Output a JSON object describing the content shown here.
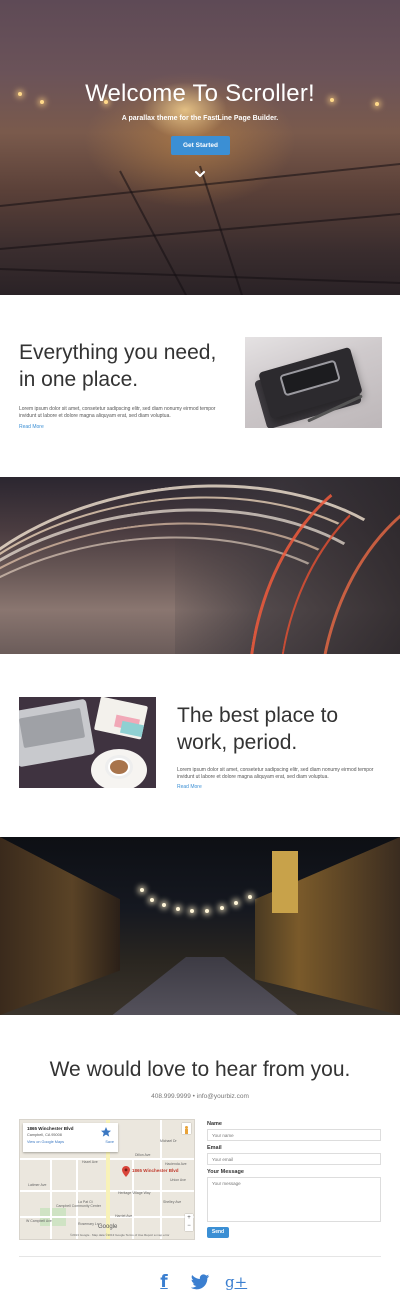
{
  "hero": {
    "title": "Welcome To Scroller!",
    "subtitle": "A parallax theme for the FastLine Page Builder.",
    "button_label": "Get Started"
  },
  "feature1": {
    "title_line1": "Everything you need,",
    "title_line2": "in one place.",
    "body_line1": "Lorem ipsum dolor sit amet, consetetur sadipscing elitr, sed diam nonumy eirmod tempor",
    "body_line2": "invidunt ut labore et dolore magna aliquyam erat, sed diam voluptua.",
    "link": "Read More"
  },
  "feature2": {
    "title_line1": "The best place to",
    "title_line2": "work, period.",
    "body_line1": "Lorem ipsum dolor sit amet, consetetur sadipscing elitr, sed diam nonumy eirmod tempor",
    "body_line2": "invidunt ut labore et dolore magna aliquyam erat, sed diam voluptua.",
    "link": "Read More"
  },
  "contact": {
    "title": "We would love to hear from you.",
    "info": "408.999.9999 • info@yourbiz.com",
    "map": {
      "card_address": "1865 Winchester Blvd",
      "card_city": "Campbell, CA 95008",
      "card_view_link": "View on Google Maps",
      "card_save": "Save",
      "pin_label": "1865 Winchester Blvd",
      "street_labels": [
        "Dillon Ave",
        "Latimer Ave",
        "Michael Dr",
        "Heritage Village Way",
        "Hacienda Ave",
        "Shelley Ave",
        "Hazel Ave",
        "La Pat Ct",
        "Campbell Community Center",
        "W Campbell Ave",
        "Rosemary Ln",
        "Union Ave",
        "Harriet Ave",
        "Google"
      ],
      "footer": "©2013 Google · Map data ©2013 Google   Terms of Use   Report a map error"
    },
    "form": {
      "name_label": "Name",
      "name_placeholder": "Your name",
      "email_label": "Email",
      "email_placeholder": "Your email",
      "message_label": "Your Message",
      "message_placeholder": "Your message",
      "send_label": "Send"
    }
  },
  "social": {
    "facebook": "f",
    "googleplus": "g+"
  },
  "icons": {
    "hero_scroll": "chevron-down-icon",
    "map_pin": "map-pin-icon",
    "map_save": "star-icon",
    "twitter": "twitter-icon"
  },
  "colors": {
    "accent": "#3b8fd4",
    "social": "#3b7fd0",
    "text": "#333333"
  }
}
